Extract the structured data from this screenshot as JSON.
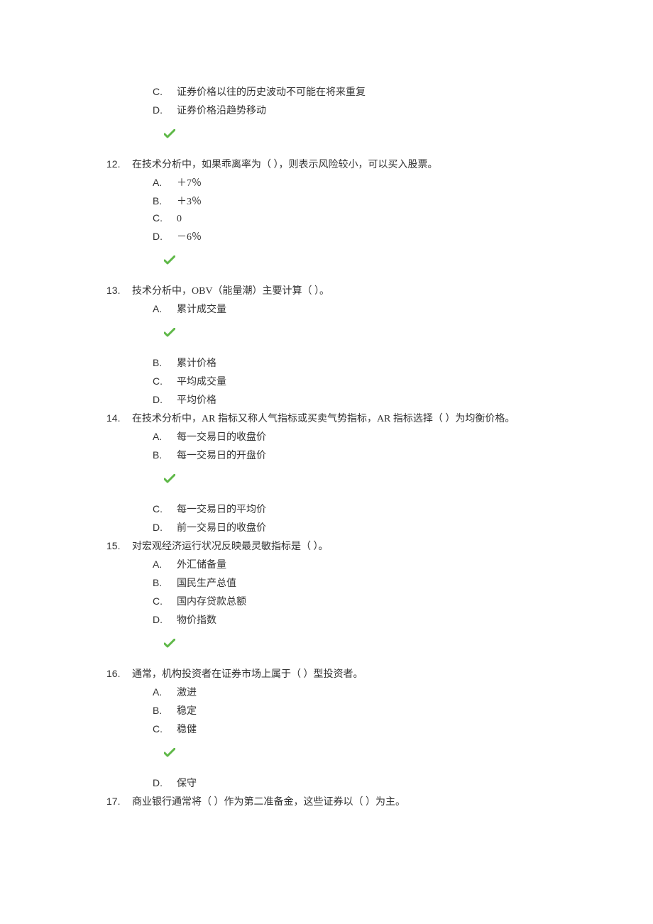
{
  "questions": [
    {
      "number": "",
      "text": "",
      "pre_options": [
        {
          "letter": "C.",
          "text": "证券价格以往的历史波动不可能在将来重复"
        },
        {
          "letter": "D.",
          "text": "证券价格沿趋势移动"
        }
      ],
      "check_after_pre": true,
      "options": []
    },
    {
      "number": "12.",
      "text": "在技术分析中，如果乖离率为（  ），则表示风险较小，可以买入股票。",
      "pre_options": [],
      "options": [
        {
          "letter": "A.",
          "text": "＋7％"
        },
        {
          "letter": "B.",
          "text": "＋3％"
        },
        {
          "letter": "C.",
          "text": "0"
        },
        {
          "letter": "D.",
          "text": "－6％"
        }
      ],
      "check_after": true
    },
    {
      "number": "13.",
      "text": "技术分析中，OBV（能量潮）主要计算（  ）。",
      "pre_options": [],
      "options_part1": [
        {
          "letter": "A.",
          "text": "累计成交量"
        }
      ],
      "check_mid": true,
      "options_part2": [
        {
          "letter": "B.",
          "text": "累计价格"
        },
        {
          "letter": "C.",
          "text": "平均成交量"
        },
        {
          "letter": "D.",
          "text": "平均价格"
        }
      ]
    },
    {
      "number": "14.",
      "text": "在技术分析中，AR 指标又称人气指标或买卖气势指标，AR 指标选择（  ）为均衡价格。",
      "pre_options": [],
      "options_part1": [
        {
          "letter": "A.",
          "text": "每一交易日的收盘价"
        },
        {
          "letter": "B.",
          "text": "每一交易日的开盘价"
        }
      ],
      "check_mid": true,
      "options_part2": [
        {
          "letter": "C.",
          "text": "每一交易日的平均价"
        },
        {
          "letter": "D.",
          "text": "前一交易日的收盘价"
        }
      ]
    },
    {
      "number": "15.",
      "text": "对宏观经济运行状况反映最灵敏指标是（  ）。",
      "pre_options": [],
      "options": [
        {
          "letter": "A.",
          "text": "外汇储备量"
        },
        {
          "letter": "B.",
          "text": "国民生产总值"
        },
        {
          "letter": "C.",
          "text": "国内存贷款总额"
        },
        {
          "letter": "D.",
          "text": "物价指数"
        }
      ],
      "check_after": true
    },
    {
      "number": "16.",
      "text": "通常，机构投资者在证券市场上属于（  ）型投资者。",
      "pre_options": [],
      "options_part1": [
        {
          "letter": "A.",
          "text": "激进"
        },
        {
          "letter": "B.",
          "text": "稳定"
        },
        {
          "letter": "C.",
          "text": "稳健"
        }
      ],
      "check_mid": true,
      "options_part2": [
        {
          "letter": "D.",
          "text": "保守"
        }
      ]
    },
    {
      "number": "17.",
      "text": "商业银行通常将（  ）作为第二准备金，这些证券以（  ）为主。",
      "pre_options": [],
      "options": []
    }
  ]
}
